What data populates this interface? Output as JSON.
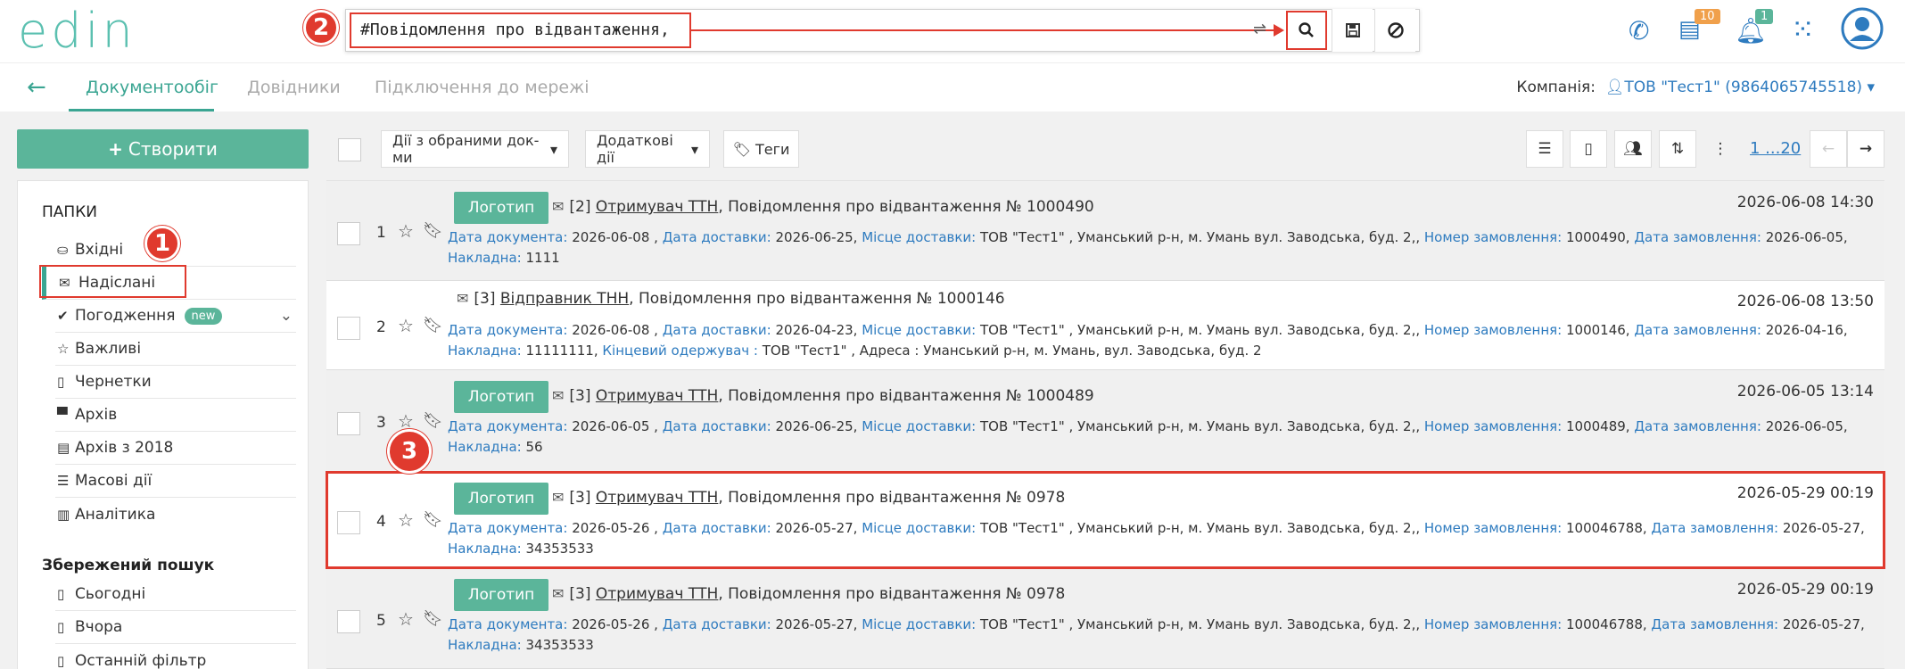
{
  "app": {
    "logo": "edin"
  },
  "search": {
    "query": "#Повідомлення про відвантаження,",
    "filter_icon": "sliders-icon",
    "search_icon": "search-icon",
    "save_icon": "save-icon",
    "clear_icon": "cancel-icon"
  },
  "annotations": {
    "n1": "1",
    "n2": "2",
    "n3": "3"
  },
  "top_icons": {
    "news_count": "10",
    "notif_count": "1"
  },
  "nav": {
    "tabs": [
      "Документообіг",
      "Довідники",
      "Підключення до мережі"
    ],
    "company_label": "Компанія:",
    "company_value": "ТОВ \"Тест1\" (9864065745518)"
  },
  "sidebar": {
    "create_label": "Створити",
    "folders_header": "ПАПКИ",
    "folders": [
      {
        "label": "Вхідні",
        "icon": "inbox-icon"
      },
      {
        "label": "Надіслані",
        "icon": "envelope-icon"
      },
      {
        "label": "Погодження",
        "icon": "check-icon",
        "badge": "new"
      },
      {
        "label": "Важливі",
        "icon": "star-icon"
      },
      {
        "label": "Чернетки",
        "icon": "file-icon"
      },
      {
        "label": "Архів",
        "icon": "archive-icon"
      },
      {
        "label": "Архів з 2018",
        "icon": "file-text-icon"
      },
      {
        "label": "Масові дії",
        "icon": "list-icon"
      },
      {
        "label": "Аналітика",
        "icon": "bar-chart-icon"
      }
    ],
    "saved_header": "Збережений пошук",
    "saved": [
      {
        "label": "Сьогодні"
      },
      {
        "label": "Вчора"
      },
      {
        "label": "Останній фільтр"
      }
    ]
  },
  "toolbar": {
    "actions_label": "Дії з обраними док-ми",
    "extra_label": "Додаткові дії",
    "tags_label": "Теги",
    "pager": "1 ...20"
  },
  "documents": [
    {
      "num": "1",
      "logo": "Логотип",
      "title_prefix": "[2] ",
      "party": "Отримувач ТТН",
      "title_rest": ", Повідомлення про відвантаження № 1000490",
      "date": "2026-06-08 14:30",
      "line1": [
        [
          "Дата документа:",
          " 2026-06-08 , "
        ],
        [
          "Дата доставки:",
          " 2026-06-25, "
        ],
        [
          "Місце доставки:",
          " ТОВ \"Тест1\" , Уманський р-н, м. Умань вул. Заводська, буд. 2,, "
        ],
        [
          "Номер замовлення:",
          " 1000490, "
        ],
        [
          "Дата замовлення:",
          " 2026-06-05,"
        ]
      ],
      "line2": [
        [
          "Накладна:",
          " 1111"
        ]
      ]
    },
    {
      "num": "2",
      "logo": "",
      "title_prefix": "[3] ",
      "party": "Відправник ТНН",
      "title_rest": ", Повідомлення про відвантаження № 1000146",
      "date": "2026-06-08 13:50",
      "line1": [
        [
          "Дата документа:",
          " 2026-06-08 , "
        ],
        [
          "Дата доставки:",
          " 2026-04-23, "
        ],
        [
          "Місце доставки:",
          " ТОВ \"Тест1\" , Уманський р-н, м. Умань вул. Заводська, буд. 2,, "
        ],
        [
          "Номер замовлення:",
          " 1000146, "
        ],
        [
          "Дата замовлення:",
          " 2026-04-16,"
        ]
      ],
      "line2": [
        [
          "Накладна:",
          " 11111111, "
        ],
        [
          "Кінцевий одержувач :",
          " ТОВ \"Тест1\" , Адреса : Уманський р-н, м. Умань, вул. Заводська, буд. 2"
        ]
      ]
    },
    {
      "num": "3",
      "logo": "Логотип",
      "title_prefix": "[3] ",
      "party": "Отримувач ТТН",
      "title_rest": ", Повідомлення про відвантаження № 1000489",
      "date": "2026-06-05 13:14",
      "line1": [
        [
          "Дата документа:",
          " 2026-06-05 , "
        ],
        [
          "Дата доставки:",
          " 2026-06-25, "
        ],
        [
          "Місце доставки:",
          " ТОВ \"Тест1\" , Уманський р-н, м. Умань вул. Заводська, буд. 2,, "
        ],
        [
          "Номер замовлення:",
          " 1000489, "
        ],
        [
          "Дата замовлення:",
          " 2026-06-05,"
        ]
      ],
      "line2": [
        [
          "Накладна:",
          " 56"
        ]
      ]
    },
    {
      "num": "4",
      "logo": "Логотип",
      "title_prefix": "[3] ",
      "party": "Отримувач ТТН",
      "title_rest": ", Повідомлення про відвантаження № 0978",
      "date": "2026-05-29 00:19",
      "line1": [
        [
          "Дата документа:",
          " 2026-05-26 , "
        ],
        [
          "Дата доставки:",
          " 2026-05-27, "
        ],
        [
          "Місце доставки:",
          " ТОВ \"Тест1\" , Уманський р-н, м. Умань вул. Заводська, буд. 2,, "
        ],
        [
          "Номер замовлення:",
          " 100046788, "
        ],
        [
          "Дата замовлення:",
          " 2026-05-27,"
        ]
      ],
      "line2": [
        [
          "Накладна:",
          " 34353533"
        ]
      ]
    },
    {
      "num": "5",
      "logo": "Логотип",
      "title_prefix": "[3] ",
      "party": "Отримувач ТТН",
      "title_rest": ", Повідомлення про відвантаження № 0978",
      "date": "2026-05-29 00:19",
      "line1": [
        [
          "Дата документа:",
          " 2026-05-26 , "
        ],
        [
          "Дата доставки:",
          " 2026-05-27, "
        ],
        [
          "Місце доставки:",
          " ТОВ \"Тест1\" , Уманський р-н, м. Умань вул. Заводська, буд. 2,, "
        ],
        [
          "Номер замовлення:",
          " 100046788, "
        ],
        [
          "Дата замовлення:",
          " 2026-05-27,"
        ]
      ],
      "line2": [
        [
          "Накладна:",
          " 34353533"
        ]
      ]
    }
  ],
  "colors": {
    "accent": "#5bb59a",
    "link": "#2e7bbf",
    "annotation": "#e03a2e"
  }
}
